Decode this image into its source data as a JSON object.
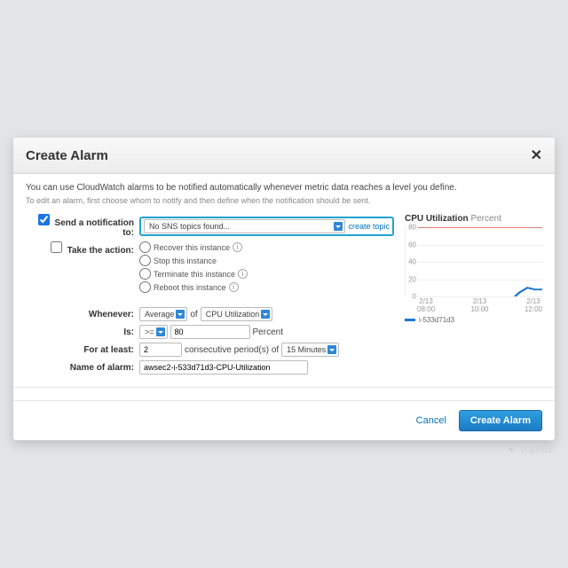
{
  "modal": {
    "title": "Create Alarm",
    "intro": "You can use CloudWatch alarms to be notified automatically whenever metric data reaches a level you define.",
    "subintro": "To edit an alarm, first choose whom to notify and then define when the notification should be sent."
  },
  "form": {
    "send_notification_label": "Send a notification to:",
    "sns_select": "No SNS topics found...",
    "create_topic": "create topic",
    "take_action_label": "Take the action:",
    "actions": {
      "recover": "Recover this instance",
      "stop": "Stop this instance",
      "terminate": "Terminate this instance",
      "reboot": "Reboot this instance"
    },
    "whenever_label": "Whenever:",
    "stat": "Average",
    "of": "of",
    "metric": "CPU Utilization",
    "is_label": "Is:",
    "op": ">=",
    "threshold": "80",
    "threshold_unit": "Percent",
    "for_at_least_label": "For at least:",
    "periods": "2",
    "periods_suffix": "consecutive period(s) of",
    "period_len": "15 Minutes",
    "name_label": "Name of alarm:",
    "name_value": "awsec2-i-533d71d3-CPU-Utilization"
  },
  "footer": {
    "cancel": "Cancel",
    "create": "Create Alarm"
  },
  "chart": {
    "title": "CPU Utilization",
    "unit": "Percent",
    "legend": "i-533d71d3"
  },
  "chart_data": {
    "type": "line",
    "title": "CPU Utilization Percent",
    "ylabel": "Percent",
    "ylim": [
      0,
      80
    ],
    "yticks": [
      0,
      20,
      40,
      60,
      80
    ],
    "threshold": 80,
    "x": [
      "2/13 08:00",
      "2/13 10:00",
      "2/13 12:00"
    ],
    "series": [
      {
        "name": "i-533d71d3",
        "color": "#1f77d0",
        "points": [
          {
            "t": "11:50",
            "v": 0
          },
          {
            "t": "12:00",
            "v": 5
          },
          {
            "t": "12:10",
            "v": 10
          },
          {
            "t": "12:20",
            "v": 8
          }
        ]
      }
    ]
  },
  "watermark": "toptal"
}
